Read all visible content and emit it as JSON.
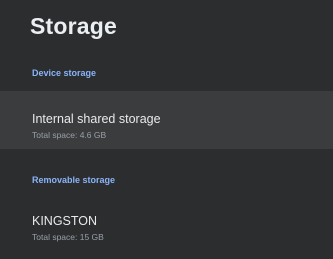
{
  "header": {
    "title": "Storage"
  },
  "sections": [
    {
      "label": "Device storage",
      "items": [
        {
          "title": "Internal shared storage",
          "subtitle": "Total space: 4.6 GB",
          "selected": true
        }
      ]
    },
    {
      "label": "Removable storage",
      "items": [
        {
          "title": "KINGSTON",
          "subtitle": "Total space: 15 GB",
          "selected": false
        }
      ]
    }
  ],
  "colors": {
    "background": "#2b2d2f",
    "selected_row": "#3a3c3e",
    "section_accent": "#8ab4f8",
    "primary_text": "#e8eaed",
    "secondary_text": "#9aa0a6"
  }
}
